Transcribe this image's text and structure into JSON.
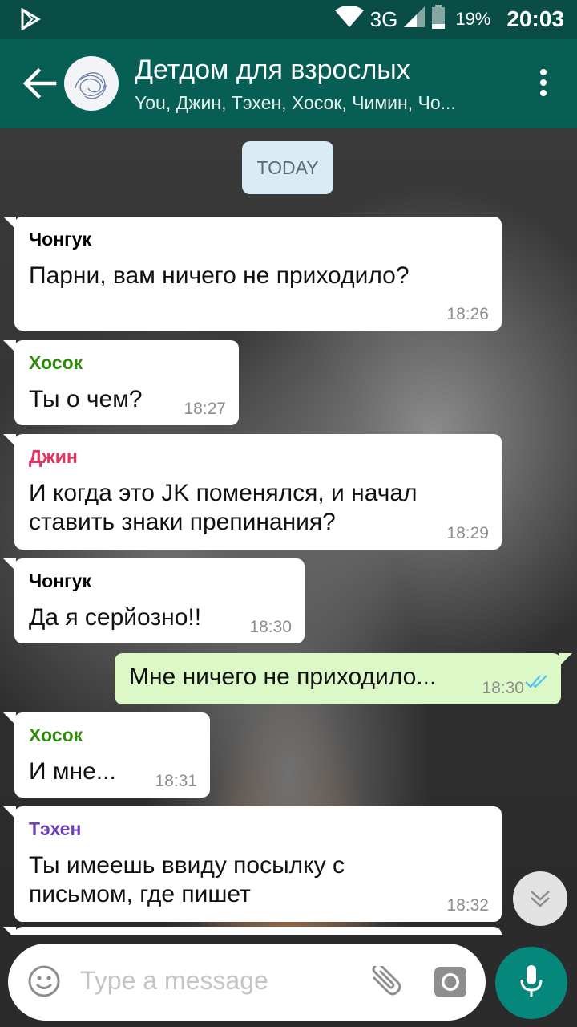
{
  "status_bar": {
    "network": "3G",
    "battery_percent": "19%",
    "time": "20:03"
  },
  "header": {
    "title": "Детдом для взрослых",
    "subtitle": "You, Джин, Тэхен, Хосок, Чимин, Чо..."
  },
  "chat": {
    "date_label": "TODAY",
    "messages": [
      {
        "sender": "Чонгук",
        "text": "Парни, вам ничего не приходило?",
        "time": "18:26"
      },
      {
        "sender": "Хосок",
        "text": "Ты о чем?",
        "time": "18:27"
      },
      {
        "sender": "Джин",
        "text": "И когда это JK поменялся, и начал ставить знаки препинания?",
        "time": "18:29"
      },
      {
        "sender": "Чонгук",
        "text": "Да я серйозно!!",
        "time": "18:30"
      },
      {
        "text": "Мне ничего не приходило...",
        "time": "18:30"
      },
      {
        "sender": "Хосок",
        "text": "И мне...",
        "time": "18:31"
      },
      {
        "sender": "Тэхен",
        "text": "Ты имеешь ввиду посылку с письмом, где пишет",
        "time": "18:32"
      }
    ]
  },
  "composer": {
    "placeholder": "Type a message"
  },
  "colors": {
    "header": "#075e54",
    "status_bar": "#0a4d47",
    "outgoing_bubble": "#dcf8c6",
    "incoming_bubble": "#ffffff",
    "sender_jungkook": "#000000",
    "sender_hoseok": "#2e8b0c",
    "sender_jin": "#e8315f",
    "sender_taehyung": "#6f3fb8",
    "read_ticks": "#4fc3f7",
    "mic_button": "#05877b"
  },
  "icons": [
    "play-store-icon",
    "wifi-icon",
    "signal-icon",
    "battery-icon",
    "back-arrow-icon",
    "more-vert-icon",
    "double-check-icon",
    "scroll-down-icon",
    "emoji-icon",
    "attach-icon",
    "camera-icon",
    "mic-icon"
  ]
}
